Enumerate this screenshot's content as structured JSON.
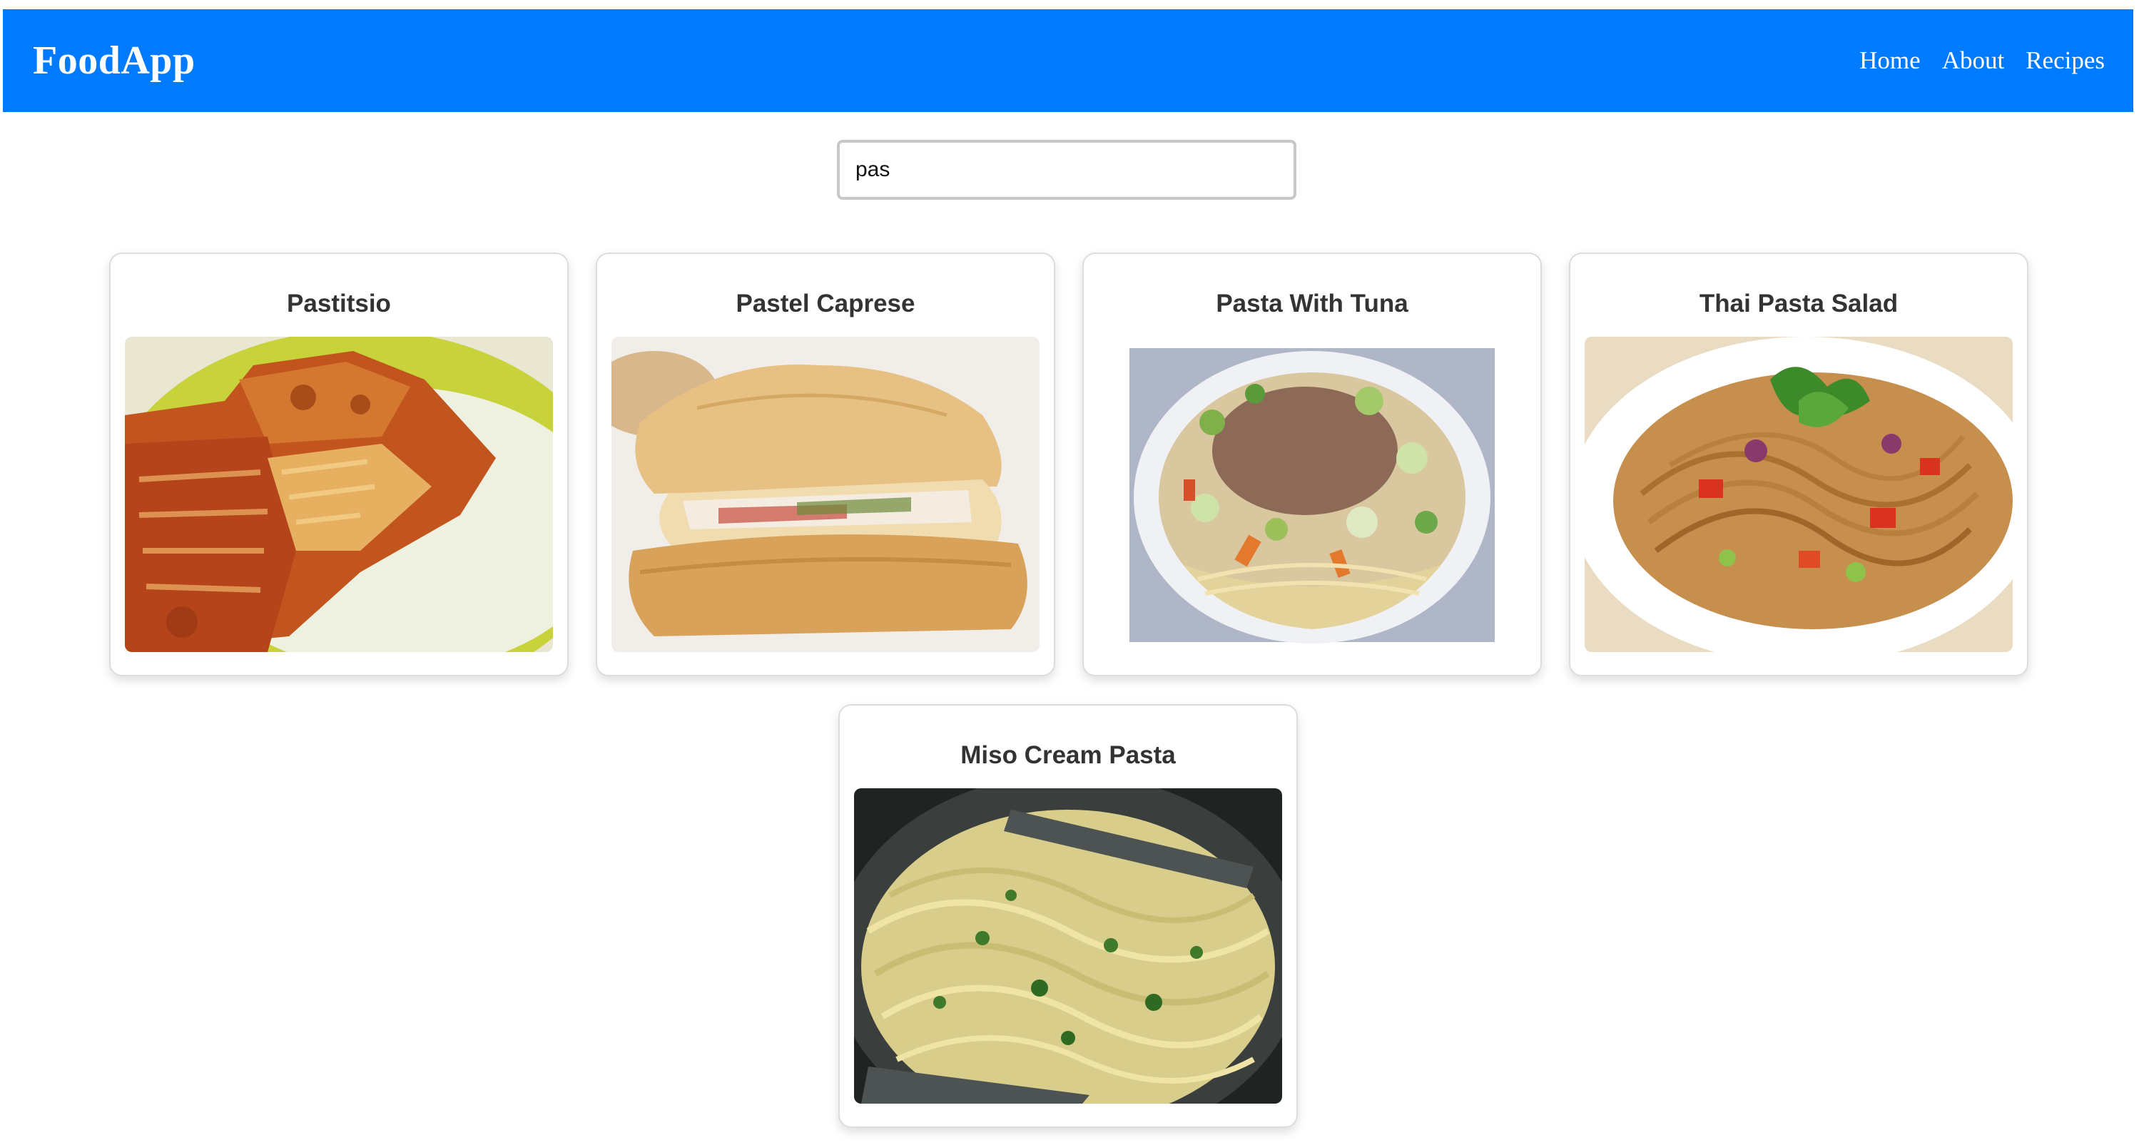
{
  "navbar": {
    "brand": "FoodApp",
    "links": [
      "Home",
      "About",
      "Recipes"
    ],
    "color": "#007bff"
  },
  "search": {
    "value": "pas"
  },
  "recipes": [
    {
      "title": "Pastitsio",
      "image": "pastitsio-photo"
    },
    {
      "title": "Pastel Caprese",
      "image": "pastel-caprese-photo"
    },
    {
      "title": "Pasta With Tuna",
      "image": "pasta-with-tuna-photo"
    },
    {
      "title": "Thai Pasta Salad",
      "image": "thai-pasta-salad-photo"
    },
    {
      "title": "Miso Cream Pasta",
      "image": "miso-cream-pasta-photo"
    }
  ]
}
